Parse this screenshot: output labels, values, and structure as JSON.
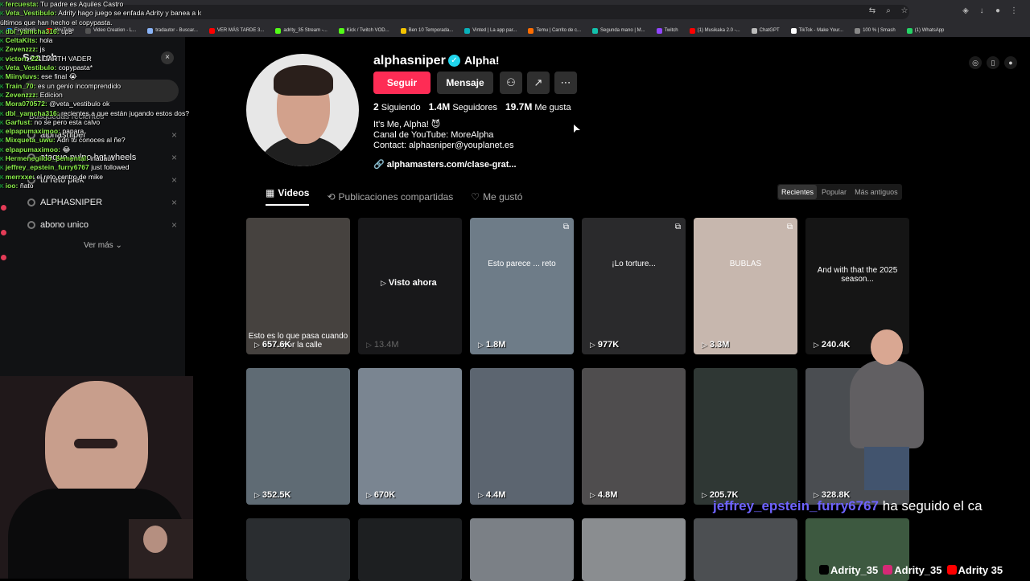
{
  "bookmarks": [
    {
      "label": "Facebook",
      "color": "#1877f2"
    },
    {
      "label": "YouTube",
      "color": "#ff0000"
    },
    {
      "label": "Video Creation - L...",
      "color": "#555"
    },
    {
      "label": "tradautor - Buscar...",
      "color": "#8ab4f8"
    },
    {
      "label": "VER MÁS TARDE 3...",
      "color": "#ff0000"
    },
    {
      "label": "adrity_35 Stream -...",
      "color": "#53fc18"
    },
    {
      "label": "Kick / Twitch VOD...",
      "color": "#53fc18"
    },
    {
      "label": "Ben 10 Temporada...",
      "color": "#f5c400"
    },
    {
      "label": "Vinted | La app par...",
      "color": "#09b1ba"
    },
    {
      "label": "Temu | Carrito de c...",
      "color": "#ff6d00"
    },
    {
      "label": "Segunda mano | M...",
      "color": "#13c1ac"
    },
    {
      "label": "Twitch",
      "color": "#9146ff"
    },
    {
      "label": "(1) Musikaka 2.0 -...",
      "color": "#ff0000"
    },
    {
      "label": "ChatGPT",
      "color": "#bbbbbb"
    },
    {
      "label": "TikTok - Make Your...",
      "color": "#ffffff"
    },
    {
      "label": "100 % | Smash",
      "color": "#888888"
    },
    {
      "label": "(1) WhatsApp",
      "color": "#25d366"
    }
  ],
  "chat": [
    {
      "user": "fercuesta:",
      "msg": "Tu padre es Aquiles Castro"
    },
    {
      "user": "Veta_Vestibulo:",
      "msg": "Adrity hago juego se enfada Adrity y banea a los"
    },
    {
      "user": "",
      "msg": "últimos que han hecho el copypasta."
    },
    {
      "user": "dbl_yamcha316:",
      "msg": "ups"
    },
    {
      "user": "CeltaKits:",
      "msg": "hola"
    },
    {
      "user": "Zevenzzz:",
      "msg": "js"
    },
    {
      "user": "victorr_22:",
      "msg": "DARTH VADER"
    },
    {
      "user": "Veta_Vestibulo:",
      "msg": "copypasta*"
    },
    {
      "user": "Miinyluvs:",
      "msg": "ese final 😭"
    },
    {
      "user": "Train_70:",
      "msg": "es un genio incomprendido"
    },
    {
      "user": "Zevenzzz:",
      "msg": "Edicion"
    },
    {
      "user": "Mora070572:",
      "msg": "@veta_vestibulo ok"
    },
    {
      "user": "dbl_yamcha316:",
      "msg": "recientes a que están jugando estos dos?"
    },
    {
      "user": "Garfust:",
      "msg": "no se pero esta calvo"
    },
    {
      "user": "elpapumaximoo:",
      "msg": "papara"
    },
    {
      "user": "Mixqueta_uwu:",
      "msg": "Adri tu conoces al ñe?"
    },
    {
      "user": "elpapumaximoo:",
      "msg": "😂"
    },
    {
      "user": "Hermenegildo_Semental:",
      "msg": "inadaux"
    },
    {
      "user": "jeffrey_epstein_furry6767",
      "msg": "just followed"
    },
    {
      "user": "merrxxe:",
      "msg": "el reto centro de mike"
    },
    {
      "user": "ioo:",
      "msg": "ñato"
    }
  ],
  "search": {
    "title": "Search",
    "close": "×",
    "recent_label": "Búsquedas recientes",
    "items": [
      "alphasniper",
      "ataque pulpo hot wheels",
      "tu reto plek",
      "ALPHASNIPER",
      "abono unico"
    ],
    "remove": "×",
    "more": "Ver más"
  },
  "profile": {
    "username": "alphasniper",
    "nickname": "Alpha!",
    "follow": "Seguir",
    "message": "Mensaje",
    "stats": [
      {
        "num": "2",
        "label": "Siguiendo"
      },
      {
        "num": "1.4M",
        "label": "Seguidores"
      },
      {
        "num": "19.7M",
        "label": "Me gusta"
      }
    ],
    "bio": [
      "It's Me, Alpha! 😈",
      "Canal de YouTube: MoreAlpha",
      "Contact: alphasniper@youplanet.es"
    ],
    "link": "alphamasters.com/clase-grat..."
  },
  "tabs": [
    "Videos",
    "Publicaciones compartidas",
    "Me gustó"
  ],
  "sorters": [
    "Recientes",
    "Popular",
    "Más antiguos"
  ],
  "videos": [
    {
      "views": "657.6K",
      "bg": "#46423f",
      "caption": "Esto es lo que pasa cuando ... por la calle"
    },
    {
      "views": "13.4M",
      "bg": "#18181a",
      "visto": "Visto ahora"
    },
    {
      "views": "1.8M",
      "bg": "#6e7c88",
      "caption": "Esto parece ... reto",
      "multi": true
    },
    {
      "views": "977K",
      "bg": "#2a2a2c",
      "caption": "¡Lo torture...",
      "multi": true
    },
    {
      "views": "3.3M",
      "bg": "#c7b7ae",
      "caption": "BUBLAS",
      "multi": true
    },
    {
      "views": "240.4K",
      "bg": "#151515",
      "caption": "And with that the 2025 season..."
    },
    {
      "views": "352.5K",
      "bg": "#5f6b74"
    },
    {
      "views": "670K",
      "bg": "#7a8591"
    },
    {
      "views": "4.4M",
      "bg": "#5c6570"
    },
    {
      "views": "4.8M",
      "bg": "#4f4d4e"
    },
    {
      "views": "205.7K",
      "bg": "#2f3734"
    },
    {
      "views": "328.8K",
      "bg": "#4a4d51"
    },
    {
      "views": "",
      "bg": "#2a2d30"
    },
    {
      "views": "",
      "bg": "#1d1f21"
    },
    {
      "views": "",
      "bg": "#7b8086"
    },
    {
      "views": "",
      "bg": "#8a8d90"
    },
    {
      "views": "",
      "bg": "#4c4f52"
    },
    {
      "views": "",
      "bg": "#3d5940"
    }
  ],
  "alert": {
    "user": "jeffrey_epstein_furry6767",
    "text": " ha seguido el ca"
  },
  "socials": [
    {
      "label": "Adrity_35",
      "color": "#000000"
    },
    {
      "label": "Adrity_35",
      "color": "#d62976"
    },
    {
      "label": "Adrity 35",
      "color": "#ff0000"
    }
  ]
}
